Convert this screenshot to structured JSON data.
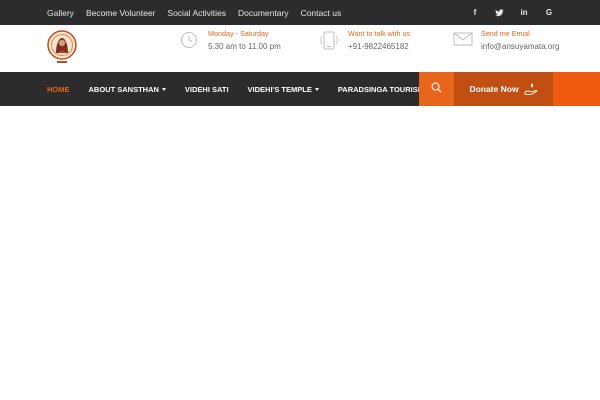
{
  "topbar": {
    "links": [
      "Gallery",
      "Become Volunteer",
      "Social Activities",
      "Documentary",
      "Contact us"
    ],
    "social": [
      "f",
      "twitter-icon",
      "in",
      "G"
    ]
  },
  "header": {
    "hours": {
      "label": "Monday - Saturday",
      "value": "5.30 am to 11.00 pm"
    },
    "phone": {
      "label": "Want to talk with us",
      "value": "+91-9822465182"
    },
    "email": {
      "label": "Send me Emial",
      "value": "info@ansuyamata.org"
    }
  },
  "nav": {
    "items": [
      {
        "label": "HOME"
      },
      {
        "label": "ABOUT SANSTHAN"
      },
      {
        "label": "VIDEHI SATI"
      },
      {
        "label": "VIDEHI'S TEMPLE"
      },
      {
        "label": "PARADSINGA TOURISM"
      }
    ],
    "donate_label": "Donate Now"
  },
  "colors": {
    "accent": "#e8661c",
    "dark": "#2c2c2c",
    "donate": "#c24f12",
    "tail": "#ef5a0f"
  }
}
